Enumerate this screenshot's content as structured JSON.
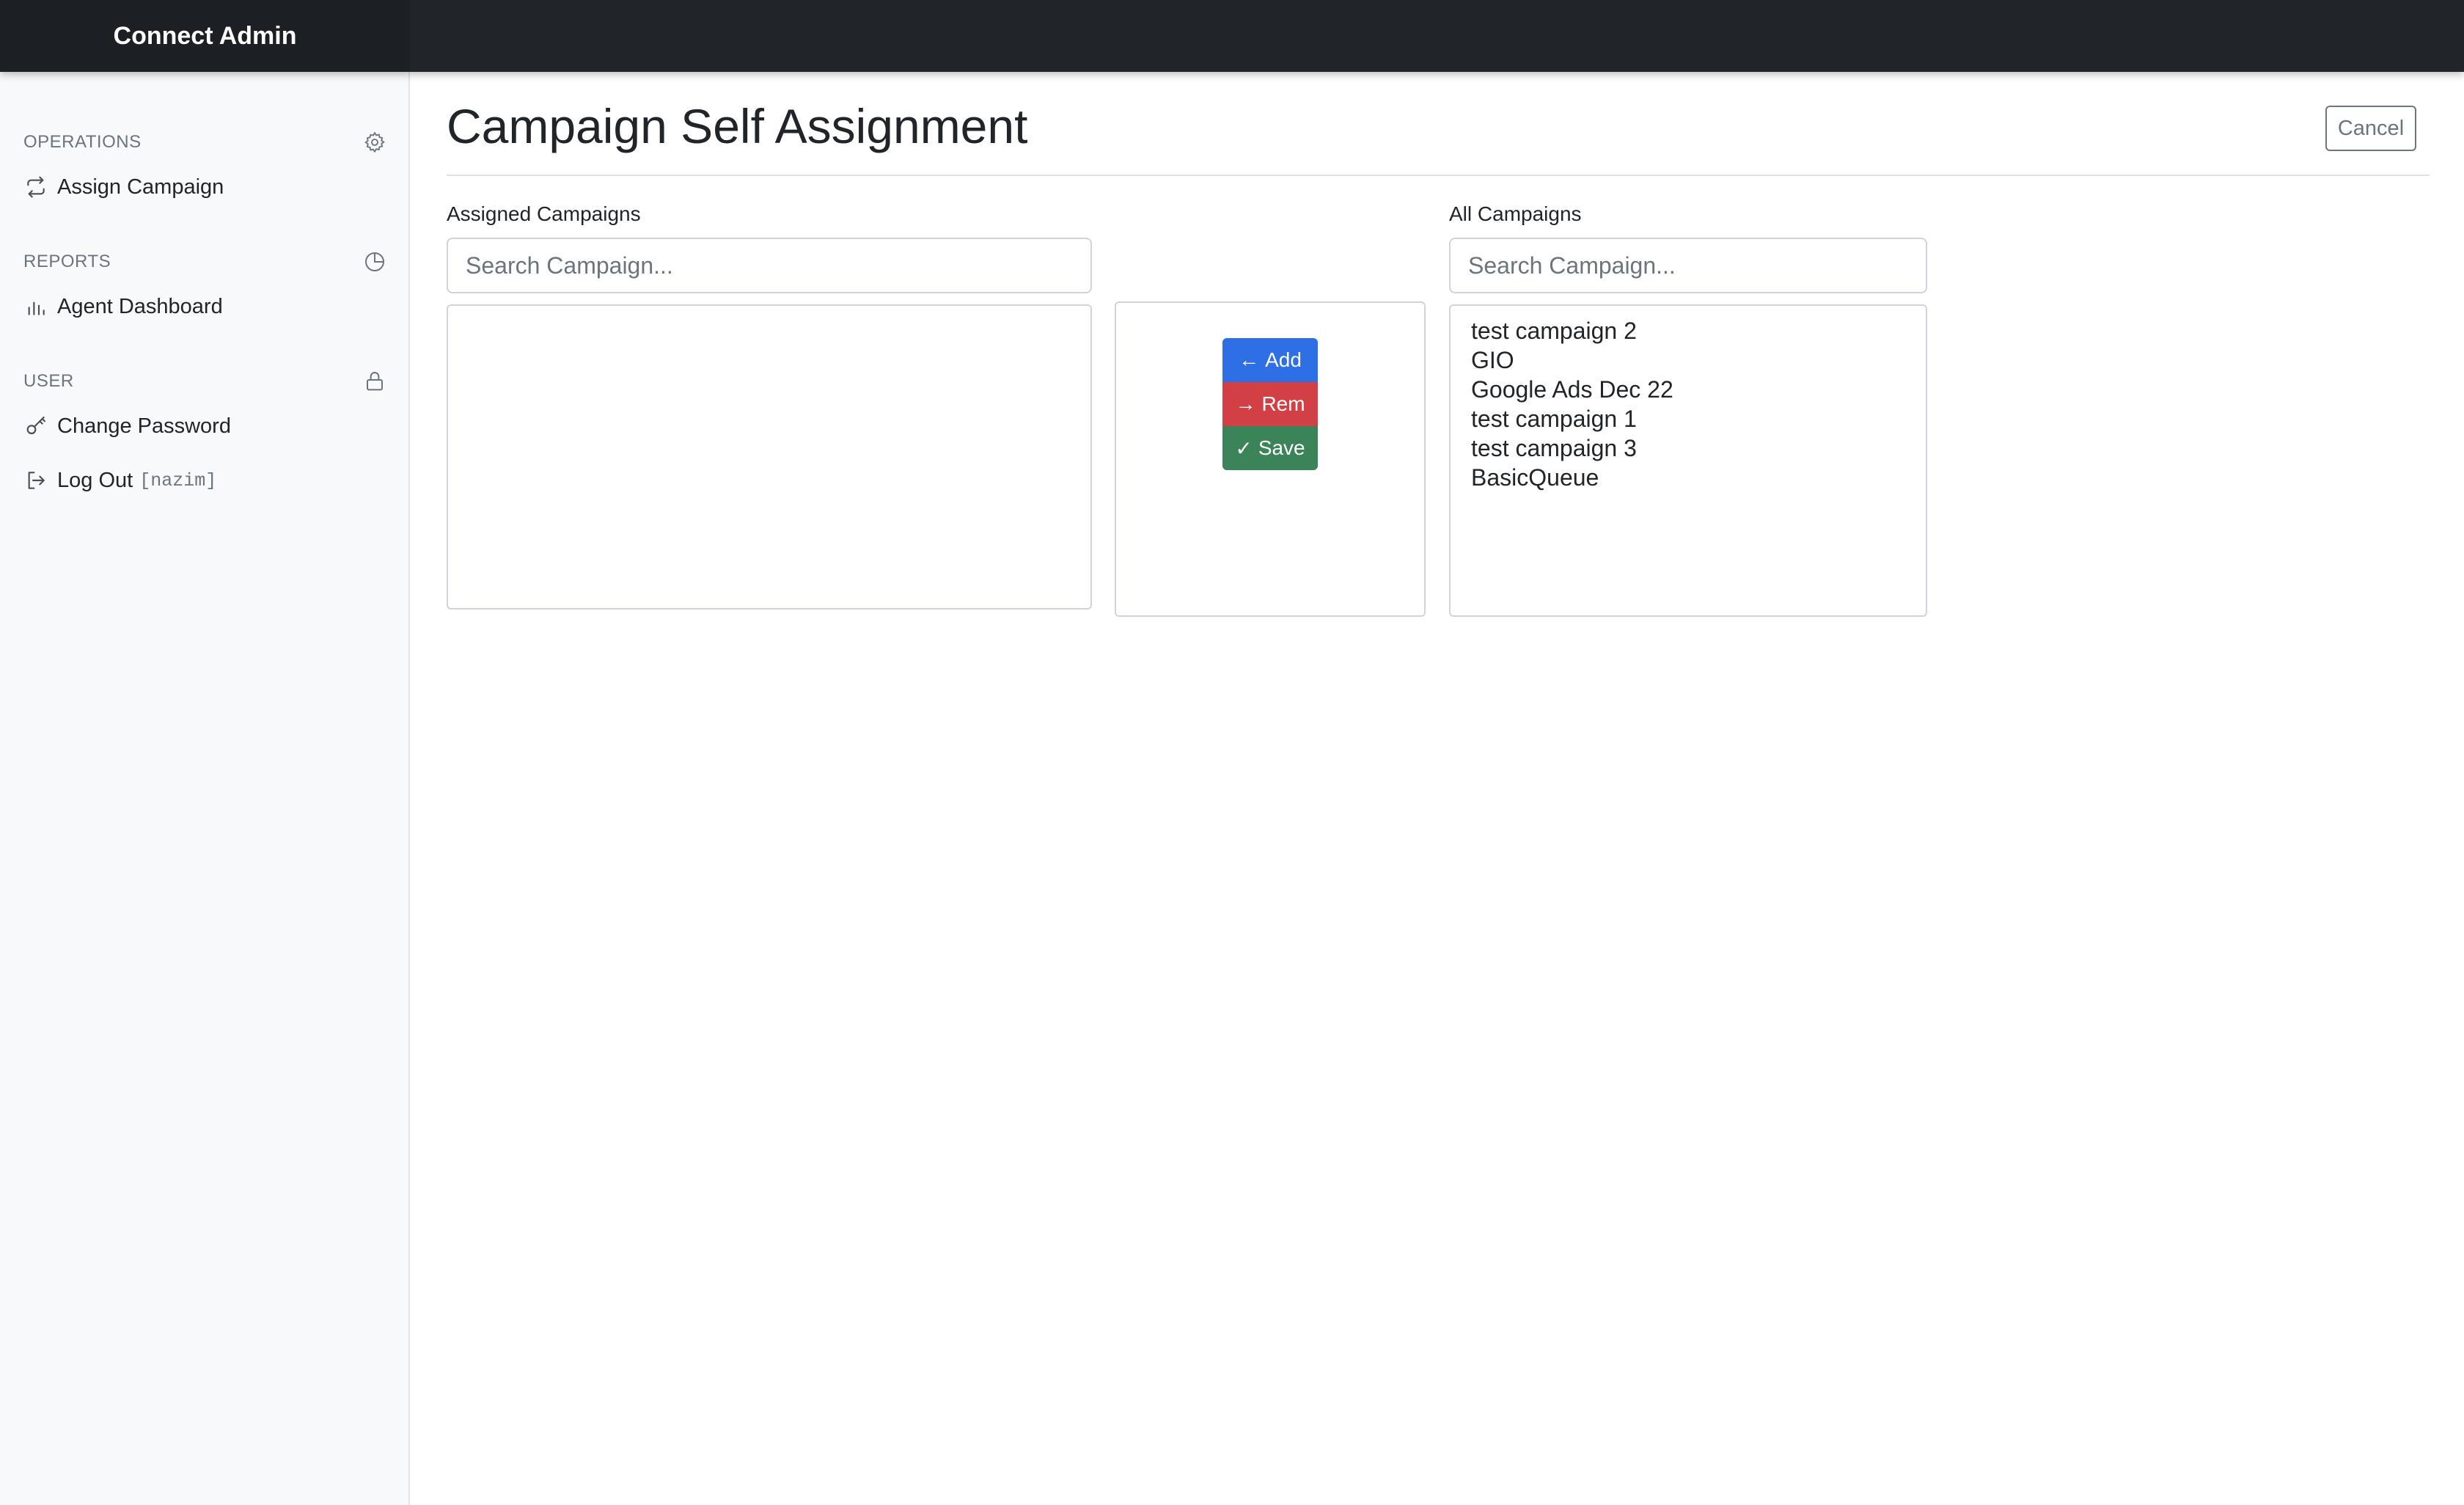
{
  "app": {
    "brand": "Connect Admin"
  },
  "sidebar": {
    "sections": [
      {
        "title": "OPERATIONS",
        "icon": "gear-icon",
        "items": [
          {
            "label": "Assign Campaign",
            "icon": "arrows-repeat-icon"
          }
        ]
      },
      {
        "title": "REPORTS",
        "icon": "pie-chart-icon",
        "items": [
          {
            "label": "Agent Dashboard",
            "icon": "bar-chart-icon"
          }
        ]
      },
      {
        "title": "USER",
        "icon": "lock-icon",
        "items": [
          {
            "label": "Change Password",
            "icon": "key-icon"
          },
          {
            "label": "Log Out",
            "icon": "logout-icon",
            "tag": "[nazim]"
          }
        ]
      }
    ]
  },
  "page": {
    "title": "Campaign Self Assignment",
    "cancel_label": "Cancel"
  },
  "assigned": {
    "label": "Assigned Campaigns",
    "search_placeholder": "Search Campaign...",
    "items": []
  },
  "all": {
    "label": "All Campaigns",
    "search_placeholder": "Search Campaign...",
    "items": [
      "test campaign 2",
      "GIO",
      "Google Ads Dec 22",
      "test campaign 1",
      "test campaign 3",
      "BasicQueue"
    ]
  },
  "actions": {
    "add": {
      "glyph": "←",
      "label": "Add",
      "color": "#2f6fe6"
    },
    "rem": {
      "glyph": "→",
      "label": "Rem",
      "color": "#d23f44"
    },
    "save": {
      "glyph": "✓",
      "label": "Save",
      "color": "#3b8358"
    }
  }
}
